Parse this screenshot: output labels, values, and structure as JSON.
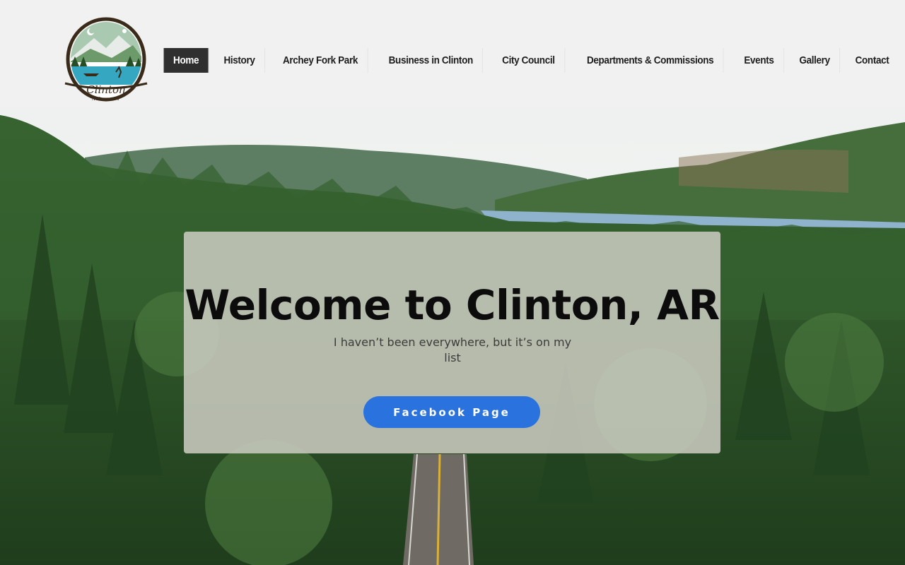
{
  "logo": {
    "name": "Clinton",
    "sub": "Arkansas"
  },
  "nav": {
    "items": [
      {
        "label": "Home",
        "active": true
      },
      {
        "label": "History"
      },
      {
        "label": "Archey Fork Park"
      },
      {
        "label": "Business in Clinton"
      },
      {
        "label": "City Council"
      },
      {
        "label": "Departments & Commissions"
      },
      {
        "label": "Events"
      },
      {
        "label": "Gallery"
      },
      {
        "label": "Contact"
      }
    ]
  },
  "hero": {
    "title": "Welcome to Clinton, AR",
    "subtitle": "I haven’t been everywhere, but it’s on my list",
    "button_label": "Facebook Page"
  },
  "colors": {
    "header_bg": "#f1f1f1",
    "nav_active_bg": "#2f2f2f",
    "button_bg": "#2a72de",
    "forest": "#2f5a2a",
    "lake": "#8fb3cc"
  }
}
